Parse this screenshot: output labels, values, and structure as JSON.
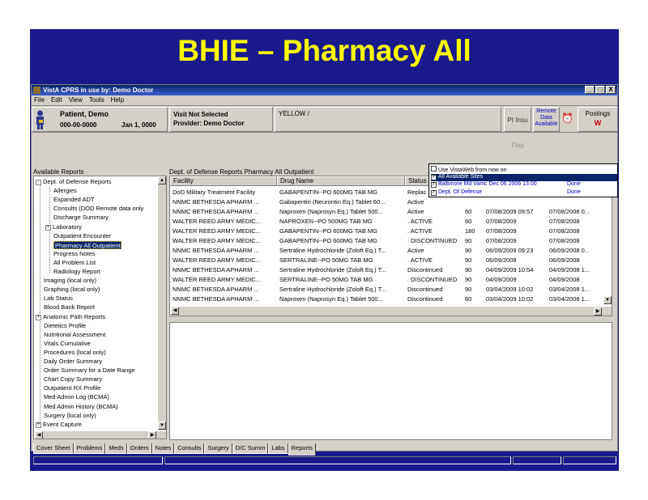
{
  "slide": {
    "title": "BHIE – Pharmacy All"
  },
  "window": {
    "title": "VistA CPRS in use by:   Demo Doctor",
    "buttons": [
      "_",
      "□",
      "X"
    ]
  },
  "menu": [
    "File",
    "Edit",
    "View",
    "Tools",
    "Help"
  ],
  "patient": {
    "name": "Patient, Demo",
    "ssn": "000-00-0000",
    "dob": "Jan 1, 0000"
  },
  "visit": {
    "line1": "Visit Not Selected",
    "line2": "Provider: Demo Doctor"
  },
  "cwad": "YELLOW /",
  "ptflag": {
    "a": "Pt Insu",
    "b": "Flag"
  },
  "remote": [
    "Remote",
    "Data",
    "Available"
  ],
  "postings": {
    "label": "Postings",
    "value": "W"
  },
  "reports": {
    "title": "Available Reports",
    "items": [
      {
        "label": "Dept. of Defense Reports",
        "expander": "-"
      },
      {
        "label": "Allergies"
      },
      {
        "label": "Expanded ADT"
      },
      {
        "label": "Consults (DOD Remote data only"
      },
      {
        "label": "Discharge Summary"
      },
      {
        "label": "Laboratory",
        "expander": "+"
      },
      {
        "label": "Outpatient Encounter"
      },
      {
        "label": "Pharmacy All Outpatient"
      },
      {
        "label": "Progress Notes"
      },
      {
        "label": "All Problem List"
      },
      {
        "label": "Radiology Report"
      },
      {
        "label": "Imaging (local only)"
      },
      {
        "label": "Graphing (local only)"
      },
      {
        "label": "Lab Status"
      },
      {
        "label": "Blood Bank Report"
      },
      {
        "label": "Anatomic Path Reports",
        "expander": "+"
      },
      {
        "label": "Dietetics Profile"
      },
      {
        "label": "Nutritional Assessment"
      },
      {
        "label": "Vitals Cumulative"
      },
      {
        "label": "Procedures (local only)"
      },
      {
        "label": "Daily Order Summary"
      },
      {
        "label": "Order Summary for a Date Range"
      },
      {
        "label": "Chart Copy Summary"
      },
      {
        "label": "Outpatient RX Profile"
      },
      {
        "label": "Med Admin Log (BCMA)"
      },
      {
        "label": "Med Admin History (BCMA)"
      },
      {
        "label": "Surgery (local only)"
      },
      {
        "label": "Event Capture",
        "expander": "+"
      }
    ]
  },
  "grid": {
    "title": "Dept. of Defense Reports Pharmacy All Outpatient",
    "columns": [
      "Facility",
      "Drug Name",
      "Status",
      "Qty",
      "Issue Date",
      "Last Filled"
    ],
    "rows": [
      [
        "DoD Military Treatment Facility",
        "GABAPENTIN--PO 600MG TAB  MG",
        "Replac",
        "",
        "",
        ""
      ],
      [
        "NNMC BETHESDA APHARM ...",
        "Gabapentin (Neurontin Eq.) Tablet 60...",
        "Active",
        "",
        "",
        ""
      ],
      [
        "NNMC BETHESDA APHARM ...",
        "Naproxen (Naprosyn Eq.) Tablet 500...",
        "Active",
        "60",
        "07/08/2009 09:57",
        "07/08/2008 0..."
      ],
      [
        "WALTER REED ARMY MEDIC...",
        "NAPROXEN--PO 500MG TAB  MG",
        ". ACTIVE",
        "60",
        "07/08/2009",
        "07/08/2008"
      ],
      [
        "WALTER REED ARMY MEDIC...",
        "GABAPENTIN--PO 600MG TAB  MG",
        ". ACTIVE",
        "180",
        "07/08/2009",
        "07/08/2008"
      ],
      [
        "WALTER REED ARMY MEDIC...",
        "GABAPENTIN--PO 600MG TAB  MG",
        ". DISCONTINUED",
        "90",
        "07/08/2009",
        "07/08/2008"
      ],
      [
        "NNMC BETHESDA APHARM ...",
        "Sertraline Hydrochloride (Zoloft Eq.) T...",
        "Active",
        "90",
        "06/09/2009 09:23",
        "06/09/2008 0..."
      ],
      [
        "WALTER REED ARMY MEDIC...",
        "SERTRALINE--PO 50MG TAB  MG",
        ". ACTIVE",
        "90",
        "06/09/2009",
        "06/09/2008"
      ],
      [
        "NNMC BETHESDA APHARM ...",
        "Sertraline Hydrochloride (Zoloft Eq.) T...",
        "Discontinued",
        "90",
        "04/09/2009 10:54",
        "04/09/2008 1..."
      ],
      [
        "WALTER REED ARMY MEDIC...",
        "SERTRALINE--PO 50MG TAB  MG",
        ". DISCONTINUED",
        "90",
        "04/09/2009",
        "04/09/2008"
      ],
      [
        "NNMC BETHESDA APHARM ...",
        "Sertraline Hydrochloride (Zoloft Eq.) T...",
        "Discontinued",
        "90",
        "03/04/2009 10:02",
        "03/04/2008 1..."
      ],
      [
        "NNMC BETHESDA APHARM ...",
        "Naproxen (Naprosyn Eq.) Tablet 500...",
        "Discontinued",
        "60",
        "03/04/2009 10:02",
        "03/04/2008 1..."
      ]
    ]
  },
  "popup": {
    "rows": [
      {
        "label": "Use VistaWeb from now on",
        "checked": false
      },
      {
        "label": "All Available Sites",
        "checked": true
      },
      {
        "label": "Baltimore Md Vamc Dec 06 2006 13:00",
        "checked": true,
        "status": "Done"
      },
      {
        "label": "Dept. Of Defense",
        "checked": true,
        "status": "Done"
      }
    ]
  },
  "tabs": [
    "Cover Sheet",
    "Problems",
    "Meds",
    "Orders",
    "Notes",
    "Consults",
    "Surgery",
    "D/C Summ",
    "Labs",
    "Reports"
  ]
}
